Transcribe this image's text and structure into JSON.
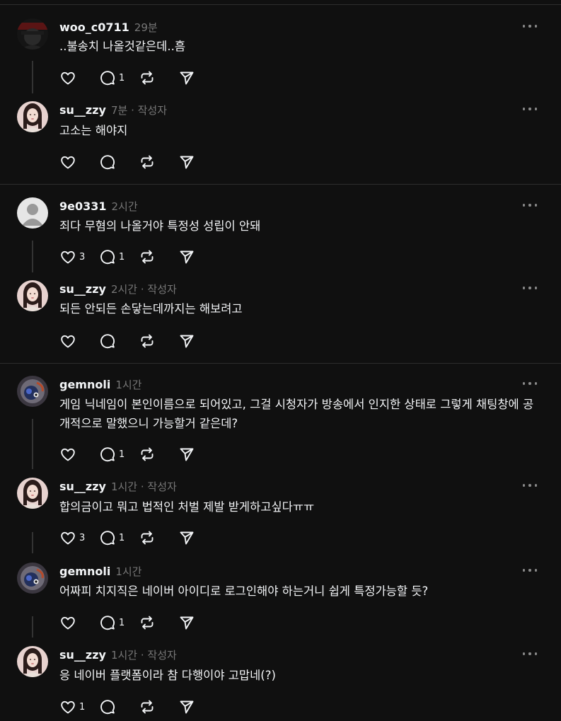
{
  "icons": {
    "like": "heart-icon",
    "reply": "comment-icon",
    "repost": "repost-icon",
    "share": "send-icon",
    "more": "more-icon"
  },
  "posts": [
    {
      "username": "woo_c0711",
      "meta": "29분",
      "text": "..불송치 나올것같은데..흠",
      "likes": "",
      "replies": "1"
    },
    {
      "username": "su__zzy",
      "meta": "7분 · 작성자",
      "text": "고소는 해야지",
      "likes": "",
      "replies": ""
    },
    {
      "username": "9e0331",
      "meta": "2시간",
      "text": "죄다 무혐의 나올거야 특정성 성립이 안돼",
      "likes": "3",
      "replies": "1"
    },
    {
      "username": "su__zzy",
      "meta": "2시간 · 작성자",
      "text": "되든 안되든 손닿는데까지는 해보려고",
      "likes": "",
      "replies": ""
    },
    {
      "username": "gemnoli",
      "meta": "1시간",
      "text": "게임 닉네임이 본인이름으로 되어있고, 그걸 시청자가 방송에서 인지한 상태로 그렇게 채팅창에 공개적으로 말했으니 가능할거 같은데?",
      "likes": "",
      "replies": "1"
    },
    {
      "username": "su__zzy",
      "meta": "1시간 · 작성자",
      "text": "합의금이고 뭐고 법적인 처벌 제발 받게하고싶다ㅠㅠ",
      "likes": "3",
      "replies": "1"
    },
    {
      "username": "gemnoli",
      "meta": "1시간",
      "text": "어짜피 치지직은 네이버 아이디로 로그인해야 하는거니 쉽게 특정가능할 듯?",
      "likes": "",
      "replies": "1"
    },
    {
      "username": "su__zzy",
      "meta": "1시간 · 작성자",
      "text": "응 네이버 플랫폼이라 참 다행이야 고맙네(?)",
      "likes": "1",
      "replies": ""
    }
  ]
}
